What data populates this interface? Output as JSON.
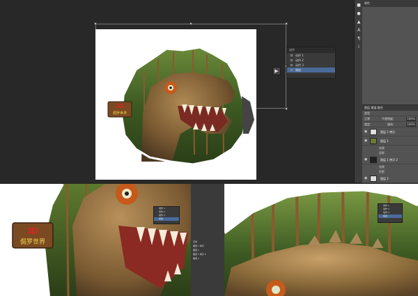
{
  "properties_panel": {
    "title": "属性"
  },
  "actions_panel": {
    "title": "动作",
    "items": [
      {
        "label": "动作 1",
        "selected": false
      },
      {
        "label": "动作 2",
        "selected": false
      },
      {
        "label": "动作 3",
        "selected": false
      },
      {
        "label": "播放",
        "selected": true
      }
    ]
  },
  "layers_panel": {
    "tabs": "图层  通道  路径",
    "kind_label": "类型",
    "blend_mode": "正常",
    "opacity_label": "不透明度:",
    "opacity": "100%",
    "lock_label": "锁定:",
    "fill_label": "填充:",
    "fill": "100%",
    "layers": [
      {
        "name": "图层 1 拷贝",
        "thumb": "light"
      },
      {
        "name": "图层 1",
        "thumb": "img"
      },
      {
        "name": "效果",
        "sub": true
      },
      {
        "name": "投影",
        "sub": true
      },
      {
        "name": "图层 1 拷贝 2",
        "thumb": "dark"
      },
      {
        "name": "效果",
        "sub": true
      },
      {
        "name": "投影",
        "sub": true
      },
      {
        "name": "图层 2",
        "thumb": "light"
      }
    ]
  },
  "logo": {
    "badge": "3D",
    "text": "侷罗世界"
  },
  "colors": {
    "app_bg": "#282828",
    "panel_bg": "#535353",
    "selection": "#4a6b9a",
    "forest_dark": "#2e3a1c",
    "forest_mid": "#5d7a2e",
    "trunk": "#8a5a2e",
    "dino_skin": "#8a6a3a",
    "dino_eye": "#c65a1a"
  }
}
